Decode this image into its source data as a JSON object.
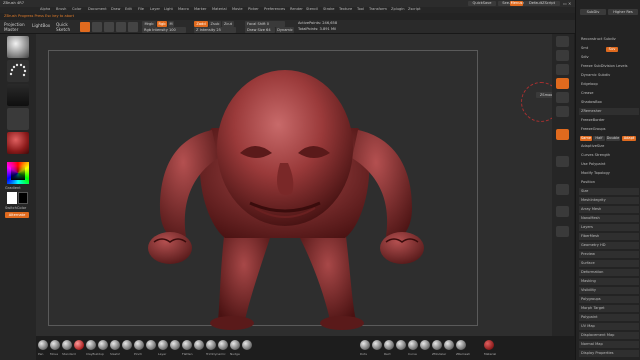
{
  "app": {
    "title": "ZBrush 4R7"
  },
  "menu": {
    "items": [
      "Alpha",
      "Brush",
      "Color",
      "Document",
      "Draw",
      "Edit",
      "File",
      "Layer",
      "Light",
      "Macro",
      "Marker",
      "Material",
      "Movie",
      "Picker",
      "Preferences",
      "Render",
      "Stencil",
      "Stroke",
      "Texture",
      "Tool",
      "Transform",
      "Zplugin",
      "Zscript"
    ]
  },
  "promo": {
    "text": "ZBrush Progress  Press Esc key to abort"
  },
  "toolbar": {
    "projection_master": "Projection Master",
    "lightbox": "LightBox",
    "quick_sketch": "Quick Sketch",
    "mrgb": "Mrgb",
    "rgb": "Rgb",
    "m": "M",
    "zadd": "Zadd",
    "zsub": "Zsub",
    "zcut": "Zcut",
    "focal_shift": "Focal Shift 0",
    "rgb_intensity": "Rgb Intensity 100",
    "z_intensity": "Z Intensity 25",
    "draw_size": "Draw Size 64",
    "dynamic": "Dynamic",
    "active_points": "ActivePoints: 246,658",
    "total_points": "TotalPoints: 3.891 Mil"
  },
  "topright": {
    "quicksave": "QuickSave",
    "see_through": "See-through  0",
    "menus": "Menus",
    "default_zscript": "DefaultZScript"
  },
  "left_shelf": {
    "gradient": "Gradient",
    "switch_color": "SwitchColor",
    "alternate": "Alternate"
  },
  "right_icons": [
    {
      "label": "Floor",
      "icon": "floor-icon"
    },
    {
      "label": "Local",
      "icon": "local-icon"
    },
    {
      "label": "Frame",
      "icon": "frame-icon"
    },
    {
      "label": "Move",
      "icon": "move-icon"
    },
    {
      "label": "Scale",
      "icon": "scale-icon"
    },
    {
      "label": "Rotate",
      "icon": "rotate-icon"
    },
    {
      "label": "PolyF",
      "icon": "polyf-icon"
    },
    {
      "label": "Transp",
      "icon": "transp-icon"
    },
    {
      "label": "Ghost",
      "icon": "ghost-icon"
    },
    {
      "label": "Solo",
      "icon": "solo-icon"
    },
    {
      "label": "Xpose",
      "icon": "xpose-icon"
    }
  ],
  "viewport": {
    "gizmo_label": "ZSmooth"
  },
  "tray": {
    "header": [
      "SubDiv",
      "Higher Res"
    ],
    "rows": [
      "Reconstruct Subdiv",
      "Smt",
      "Suv",
      "ReUV",
      "Sdiv",
      "Freeze SubDivision Levels",
      "Dynamic Subdiv",
      "Edgeloop",
      "Crease",
      "ShadowBox",
      "ClayPolish",
      "DynaMesh",
      "Groups",
      "Polish",
      "Blur",
      "Project",
      "Resolution",
      "Sub Projection",
      "Tessimate",
      "ZRemesher",
      "FreezeBorder",
      "FreezeGroups",
      "KeepGroups",
      "Same",
      "Half",
      "Double",
      "Adapt",
      "AdaptiveSize",
      "Curves Strength",
      "Use Polypaint",
      "Modify Topology",
      "Position",
      "Size",
      "MeshIntegrity",
      "Array Mesh",
      "NanoMesh",
      "Layers",
      "FiberMesh",
      "Geometry HD",
      "Preview",
      "Surface",
      "Deformation",
      "Masking",
      "Visibility",
      "Polygroups",
      "Contact",
      "Morph Target",
      "Polypaint",
      "UV Map",
      "Texture Map",
      "Displacement Map",
      "Normal Map",
      "Vector Displacement Map",
      "Display Properties",
      "Unified Skin"
    ]
  },
  "bottom": {
    "brushes": [
      "Pen",
      "Move",
      "Standard",
      "Inflat",
      "ClayBuildup",
      "DamStandard",
      "Slash2",
      "Polish",
      "Pinch",
      "Morph",
      "Layer",
      "ClayTubes",
      "Flatten",
      "hPolish",
      "TrimDynamic",
      "Move Topological",
      "Nudge",
      "SnakeHook"
    ],
    "alphas": [
      "Dots",
      "FreeHand",
      "Rect",
      "Circle",
      "Curve",
      "Lasso",
      "ZModeler",
      "Topology",
      "ZRemesh",
      "Alpha Off",
      "Texture Off",
      "Gradient"
    ],
    "material_label": "Material",
    "color_accent": "#e06a1e"
  }
}
